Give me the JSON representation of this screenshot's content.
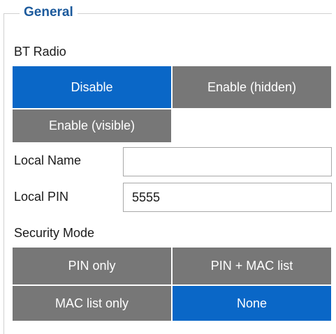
{
  "group": {
    "title": "General"
  },
  "bt_radio": {
    "label": "BT Radio",
    "options": [
      {
        "label": "Disable",
        "selected": true
      },
      {
        "label": "Enable (hidden)",
        "selected": false
      },
      {
        "label": "Enable (visible)",
        "selected": false
      }
    ]
  },
  "local_name": {
    "label": "Local Name",
    "value": ""
  },
  "local_pin": {
    "label": "Local PIN",
    "value": "5555"
  },
  "security_mode": {
    "label": "Security Mode",
    "options": [
      {
        "label": "PIN only",
        "selected": false
      },
      {
        "label": "PIN + MAC list",
        "selected": false
      },
      {
        "label": "MAC list only",
        "selected": false
      },
      {
        "label": "None",
        "selected": true
      }
    ]
  },
  "colors": {
    "selected": "#0a67c7",
    "unselected": "#777777",
    "legend": "#1c5a9c"
  }
}
